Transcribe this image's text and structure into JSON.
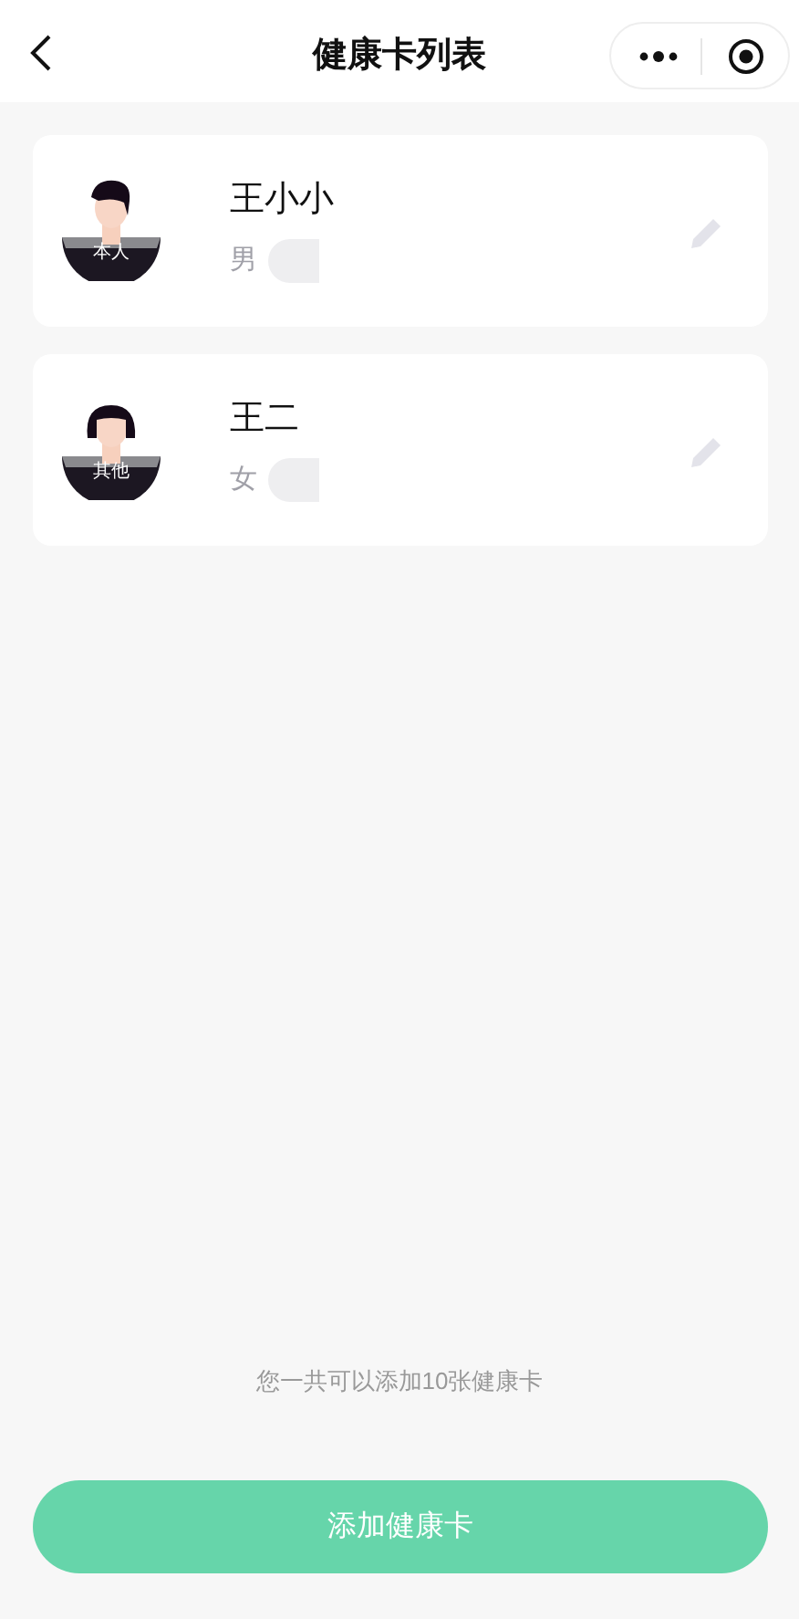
{
  "nav": {
    "title": "健康卡列表"
  },
  "cards": [
    {
      "name": "王小小",
      "gender": "男",
      "badge": "本人",
      "kind": "male"
    },
    {
      "name": "王二",
      "gender": "女",
      "badge": "其他",
      "kind": "female"
    }
  ],
  "footer_note": "您一共可以添加10张健康卡",
  "add_button": "添加健康卡"
}
